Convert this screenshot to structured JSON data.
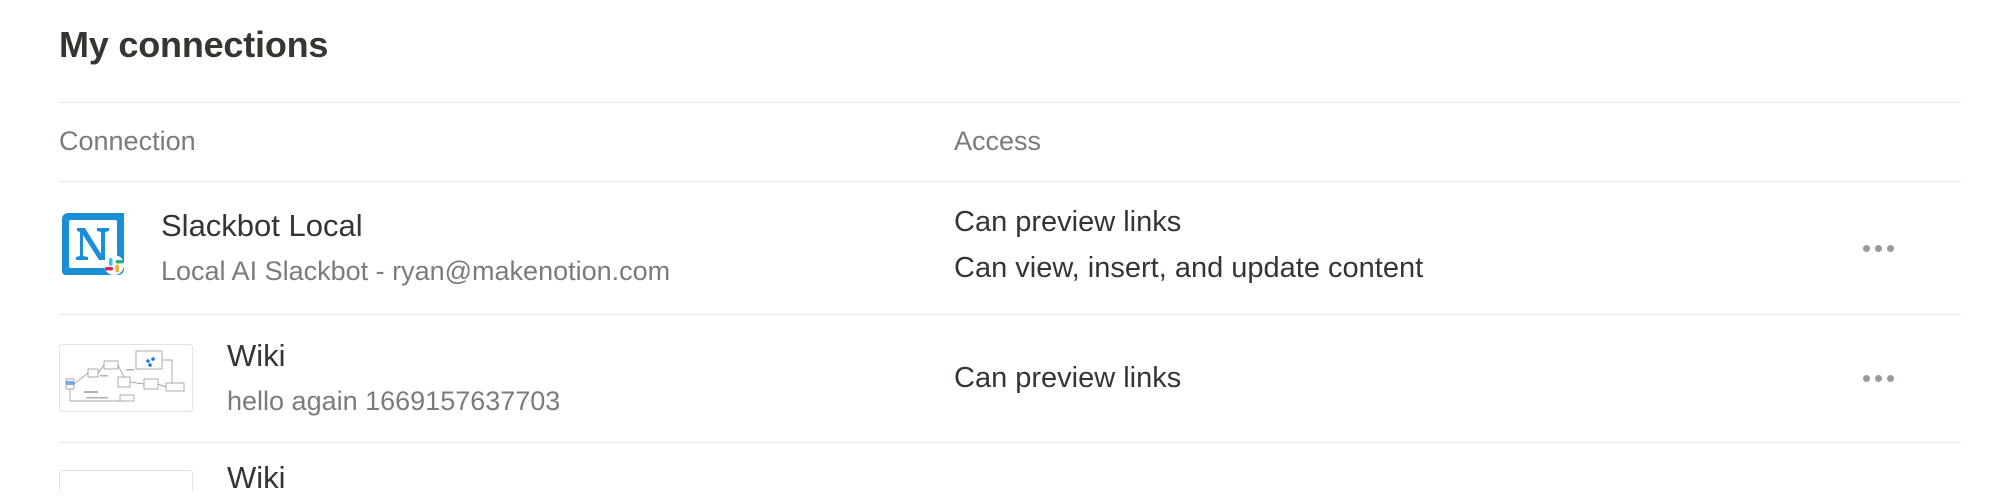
{
  "header": {
    "title": "My connections"
  },
  "table": {
    "columns": {
      "connection": "Connection",
      "access": "Access"
    },
    "rows": [
      {
        "name": "Slackbot Local",
        "description": "Local AI Slackbot - ryan@makenotion.com",
        "icon": "notion-slack-logo-icon",
        "access": [
          "Can preview links",
          "Can view, insert, and update content"
        ]
      },
      {
        "name": "Wiki",
        "description": "hello again 1669157637703",
        "icon": "diagram-thumbnail",
        "access": [
          "Can preview links"
        ]
      },
      {
        "name": "Wiki",
        "icon": "diagram-thumbnail"
      }
    ]
  },
  "colors": {
    "text_primary": "#37352f",
    "text_secondary": "#7d7b76",
    "divider": "#e9e9e7",
    "notion_blue": "#1a8fd6"
  }
}
